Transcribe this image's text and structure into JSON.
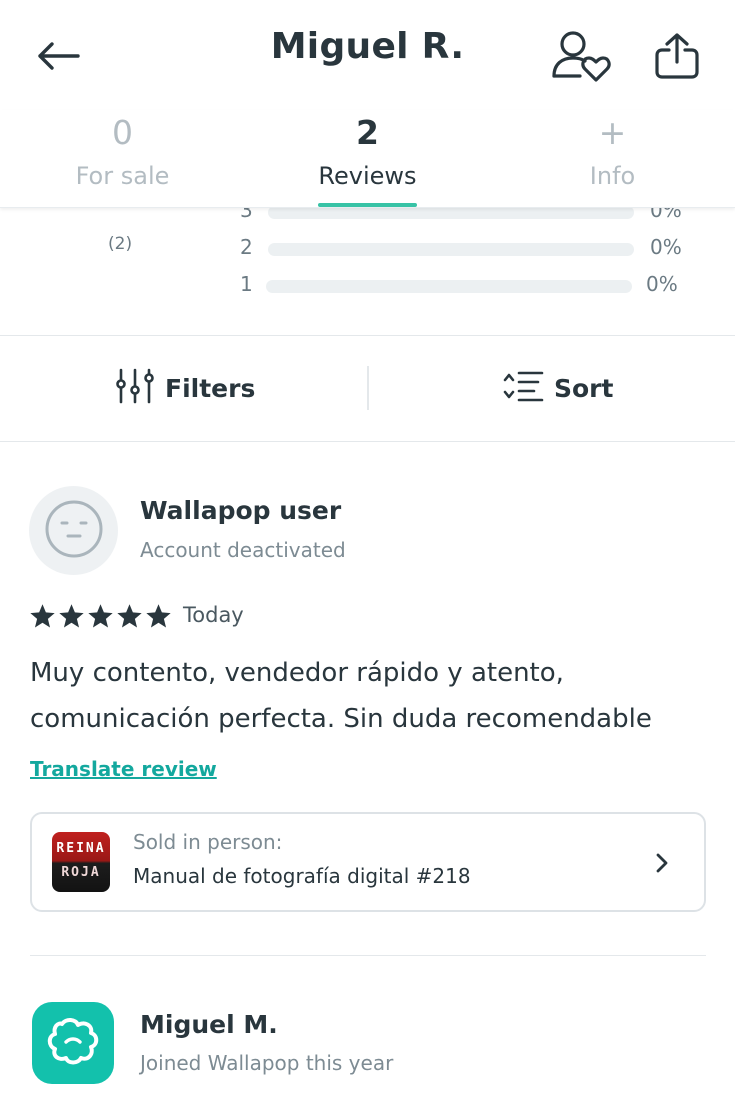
{
  "header": {
    "title": "Miguel R.",
    "back_icon": "arrow-left-icon",
    "favorite_icon": "user-heart-icon",
    "share_icon": "share-icon"
  },
  "tabs": [
    {
      "value": "0",
      "label": "For sale",
      "active": false
    },
    {
      "value": "2",
      "label": "Reviews",
      "active": true
    },
    {
      "value": "+",
      "label": "Info",
      "active": false
    }
  ],
  "ratings": {
    "count": "(2)",
    "rows": [
      {
        "stars": "3",
        "percent": "0%",
        "fill": 0
      },
      {
        "stars": "2",
        "percent": "0%",
        "fill": 0
      },
      {
        "stars": "1",
        "percent": "0%",
        "fill": 0
      }
    ]
  },
  "toolbar": {
    "filters_label": "Filters",
    "sort_label": "Sort"
  },
  "reviews": [
    {
      "author": "Wallapop user",
      "subtitle": "Account deactivated",
      "rating": 5,
      "date": "Today",
      "text": "Muy contento, vendedor rápido y atento, comunicación perfecta. Sin duda recomendable",
      "translate_label": "Translate review",
      "item": {
        "type": "Sold in person:",
        "title": "Manual de fotografía digital #218",
        "thumb_line1": "REINA",
        "thumb_line2": "ROJA"
      }
    },
    {
      "author": "Miguel M.",
      "subtitle": "Joined Wallapop this year"
    }
  ],
  "colors": {
    "accent": "#38c3a6",
    "link": "#13a89e",
    "text": "#29363d",
    "muted": "#7d8b93"
  }
}
